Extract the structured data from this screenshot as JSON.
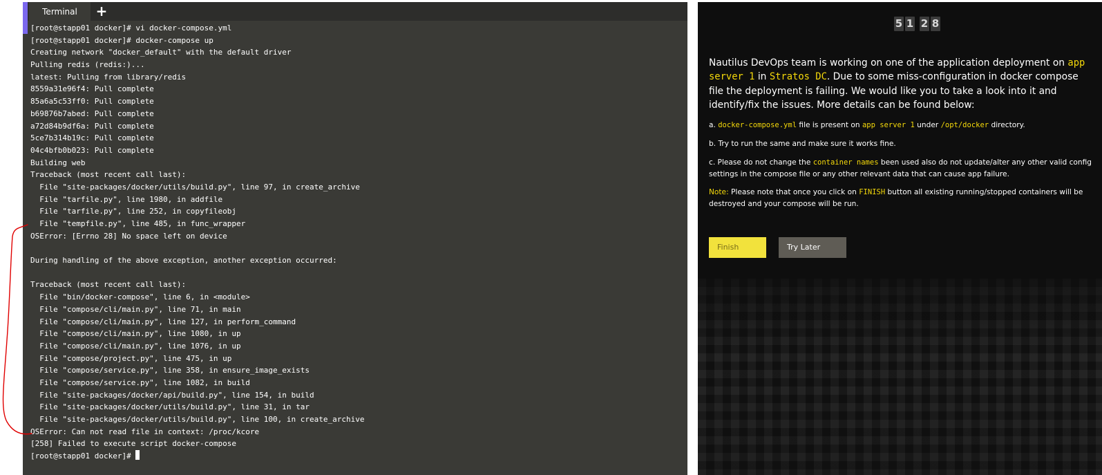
{
  "terminal": {
    "tab_label": "Terminal",
    "add_tab_symbol": "+",
    "lines": [
      "[root@stapp01 docker]# vi docker-compose.yml",
      "[root@stapp01 docker]# docker-compose up",
      "Creating network \"docker_default\" with the default driver",
      "Pulling redis (redis:)...",
      "latest: Pulling from library/redis",
      "8559a31e96f4: Pull complete",
      "85a6a5c53ff0: Pull complete",
      "b69876b7abed: Pull complete",
      "a72d84b9df6a: Pull complete",
      "5ce7b314b19c: Pull complete",
      "04c4bfb0b023: Pull complete",
      "Building web",
      "Traceback (most recent call last):",
      "  File \"site-packages/docker/utils/build.py\", line 97, in create_archive",
      "  File \"tarfile.py\", line 1980, in addfile",
      "  File \"tarfile.py\", line 252, in copyfileobj",
      "  File \"tempfile.py\", line 485, in func_wrapper",
      "OSError: [Errno 28] No space left on device",
      "",
      "During handling of the above exception, another exception occurred:",
      "",
      "Traceback (most recent call last):",
      "  File \"bin/docker-compose\", line 6, in <module>",
      "  File \"compose/cli/main.py\", line 71, in main",
      "  File \"compose/cli/main.py\", line 127, in perform_command",
      "  File \"compose/cli/main.py\", line 1080, in up",
      "  File \"compose/cli/main.py\", line 1076, in up",
      "  File \"compose/project.py\", line 475, in up",
      "  File \"compose/service.py\", line 358, in ensure_image_exists",
      "  File \"compose/service.py\", line 1082, in build",
      "  File \"site-packages/docker/api/build.py\", line 154, in build",
      "  File \"site-packages/docker/utils/build.py\", line 31, in tar",
      "  File \"site-packages/docker/utils/build.py\", line 100, in create_archive",
      "OSError: Can not read file in context: /proc/kcore",
      "[258] Failed to execute script docker-compose"
    ],
    "prompt": "[root@stapp01 docker]# ",
    "annotation_color": "#e00000"
  },
  "task": {
    "timer": [
      "5",
      "1",
      "2",
      "8"
    ],
    "intro": {
      "p1": "Nautilus DevOps team is working on one of the application deployment on ",
      "server": "app server 1",
      "p2": " in ",
      "dc": "Stratos DC",
      "p3": ". Due to some miss-configuration in docker compose file the deployment is failing. We would like you to take a look into it and identify/fix the issues. More details can be found below:"
    },
    "item_a": {
      "prefix": "a. ",
      "file": "docker-compose.yml",
      "mid1": " file is present on ",
      "server": "app server 1",
      "mid2": " under ",
      "dir": "/opt/docker",
      "suffix": " directory."
    },
    "item_b": "b. Try to run the same and make sure it works fine.",
    "item_c": {
      "prefix": "c. Please do not change the ",
      "term": "container names",
      "suffix": " been used also do not update/alter any other valid config settings in the compose file or any other relevant data that can cause app failure."
    },
    "note": {
      "label": "Note:",
      "p1": " Please note that once you click on ",
      "finish": "FINISH",
      "p2": " button all existing running/stopped containers will be destroyed and your compose will be run."
    },
    "finish_button": "Finish",
    "try_later_button": "Try Later",
    "accent_color": "#f5d90a"
  }
}
